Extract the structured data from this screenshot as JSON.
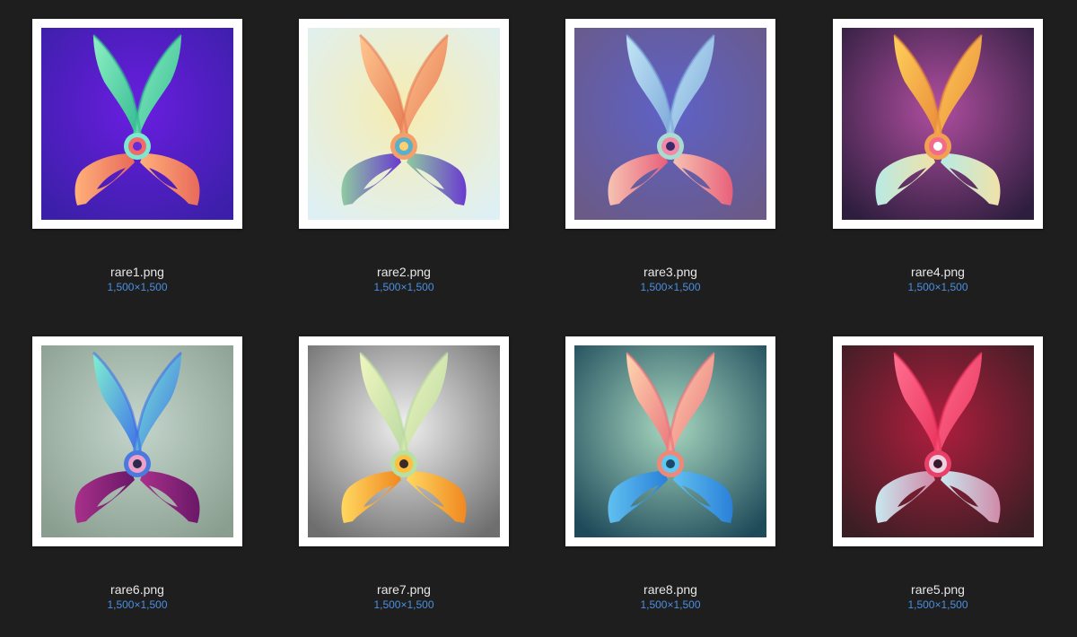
{
  "files": [
    {
      "name": "rare1.png",
      "dims": "1,500×1,500",
      "bg_inner": "#6a1ee0",
      "bg_outer": "#3b1fa8",
      "blade_light": "#8ef0c4",
      "blade_dark": "#2fb88e",
      "handle_light": "#ffb07a",
      "handle_dark": "#e86a5a",
      "ring": "#7ce8d0",
      "hub": "#f06a6a",
      "hub_glyph": "#6a2ad8"
    },
    {
      "name": "rare2.png",
      "dims": "1,500×1,500",
      "bg_inner": "#f6ecb0",
      "bg_outer": "#dff0f4",
      "blade_light": "#ffc690",
      "blade_dark": "#e67a52",
      "handle_light": "#8fcaa0",
      "handle_dark": "#6a3ad0",
      "ring": "#f4a06a",
      "hub": "#5ab0c8",
      "hub_glyph": "#ffd070"
    },
    {
      "name": "rare3.png",
      "dims": "1,500×1,500",
      "bg_inner": "#5e62c8",
      "bg_outer": "#6a5a88",
      "blade_light": "#c2e6f6",
      "blade_dark": "#7aa6d8",
      "handle_light": "#f6c2b2",
      "handle_dark": "#e8607a",
      "ring": "#a8dcd0",
      "hub": "#f08aa8",
      "hub_glyph": "#3a2a6a"
    },
    {
      "name": "rare4.png",
      "dims": "1,500×1,500",
      "bg_inner": "#b04ea0",
      "bg_outer": "#2e1e3e",
      "blade_light": "#ffd05a",
      "blade_dark": "#e88838",
      "handle_light": "#b8eae4",
      "handle_dark": "#f0e2a8",
      "ring": "#f0a050",
      "hub": "#f46a8a",
      "hub_glyph": "#ffffff"
    },
    {
      "name": "rare6.png",
      "dims": "1,500×1,500",
      "bg_inner": "#c4d6cc",
      "bg_outer": "#8a9e90",
      "blade_light": "#80f0d0",
      "blade_dark": "#3a68e8",
      "handle_light": "#a8308a",
      "handle_dark": "#6a1868",
      "ring": "#4a7ae0",
      "hub": "#f0a0c8",
      "hub_glyph": "#2a2a4a"
    },
    {
      "name": "rare7.png",
      "dims": "1,500×1,500",
      "bg_inner": "#f0f0f0",
      "bg_outer": "#6e6e6e",
      "blade_light": "#f0f6c0",
      "blade_dark": "#b8d8a0",
      "handle_light": "#ffd860",
      "handle_dark": "#f08820",
      "ring": "#b8e0a0",
      "hub": "#ffc040",
      "hub_glyph": "#3a2a2a"
    },
    {
      "name": "rare8.png",
      "dims": "1,500×1,500",
      "bg_inner": "#a8d8c0",
      "bg_outer": "#1e4a5a",
      "blade_light": "#ffd6b0",
      "blade_dark": "#e8707a",
      "handle_light": "#60c0f0",
      "handle_dark": "#2a80d8",
      "ring": "#f08878",
      "hub": "#60c8f0",
      "hub_glyph": "#1a4a6a"
    },
    {
      "name": "rare5.png",
      "dims": "1,500×1,500",
      "bg_inner": "#b01e3e",
      "bg_outer": "#3a1e24",
      "blade_light": "#ff7090",
      "blade_dark": "#e8305a",
      "handle_light": "#c8e8f0",
      "handle_dark": "#d08aa8",
      "ring": "#e84068",
      "hub": "#f0d0e0",
      "hub_glyph": "#3a1a2a"
    }
  ]
}
